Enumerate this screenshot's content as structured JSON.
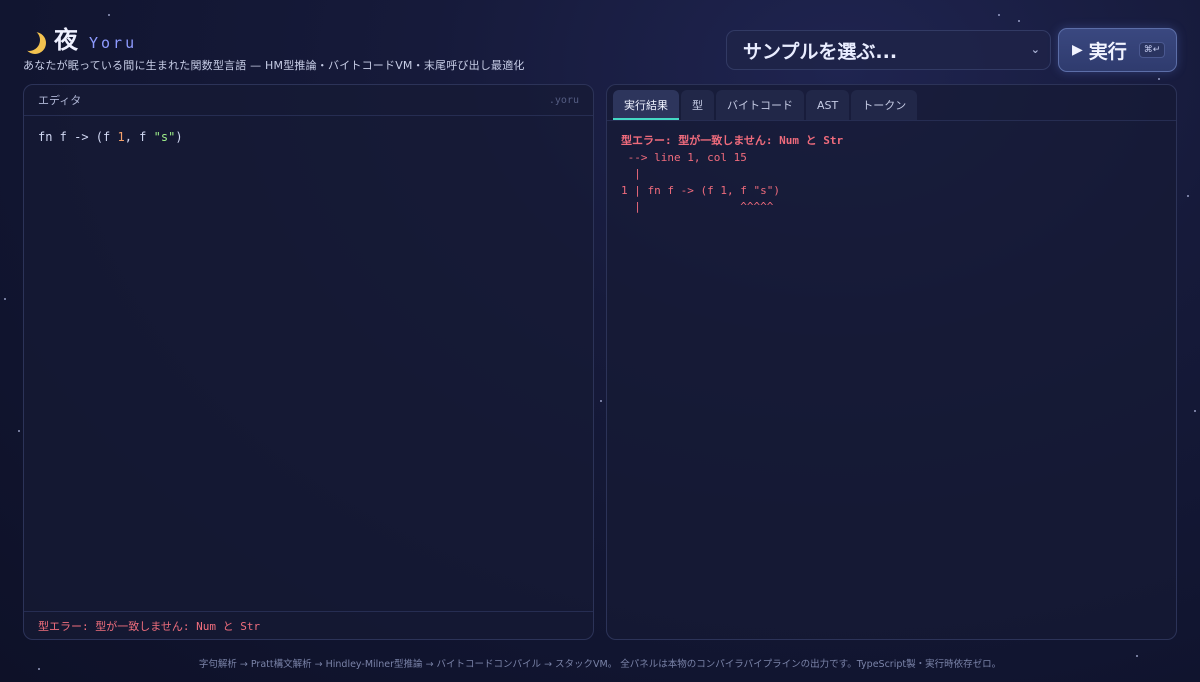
{
  "header": {
    "brand_kanji": "夜",
    "brand_latin": "Yoru",
    "tagline": "あなたが眠っている間に生まれた関数型言語 — HM型推論・バイトコードVM・末尾呼び出し最適化"
  },
  "toolbar": {
    "sample_select_label": "サンプルを選ぶ...",
    "run_label": "実行",
    "run_shortcut": "⌘↵"
  },
  "editor": {
    "title": "エディタ",
    "file_ext": ".yoru",
    "code_prefix": "fn f -> (f ",
    "code_num": "1",
    "code_mid": ", f ",
    "code_str": "\"s\"",
    "code_suffix": ")",
    "status": "型エラー: 型が一致しません: Num と Str"
  },
  "output_panel": {
    "tabs": [
      {
        "label": "実行結果",
        "active": true
      },
      {
        "label": "型",
        "active": false
      },
      {
        "label": "バイトコード",
        "active": false
      },
      {
        "label": "AST",
        "active": false
      },
      {
        "label": "トークン",
        "active": false
      }
    ],
    "lines": [
      "型エラー: 型が一致しません: Num と Str",
      " --> line 1, col 15",
      "  |",
      "1 | fn f -> (f 1, f \"s\")",
      "  |               ^^^^^"
    ]
  },
  "footer": {
    "text": "字句解析 → Pratt構文解析 → Hindley-Milner型推論 → バイトコードコンパイル → スタックVM。 全パネルは本物のコンパイラパイプラインの出力です。TypeScript製・実行時依存ゼロ。"
  },
  "colors": {
    "accent_teal": "#44d9c4",
    "error": "#ef6b7c",
    "moon": "#f3c24f"
  }
}
